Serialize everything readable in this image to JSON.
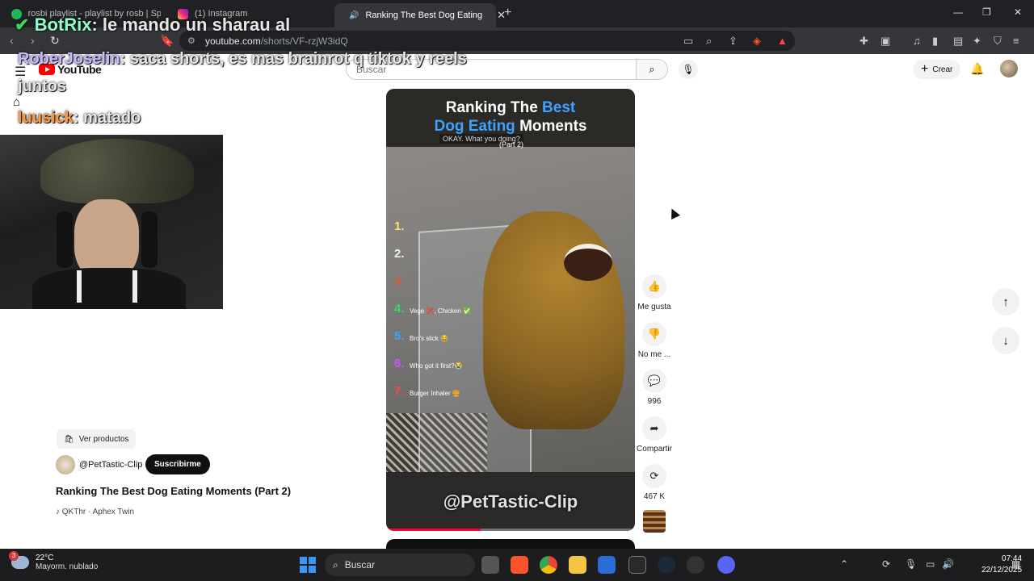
{
  "browser": {
    "tabs": [
      {
        "title": "rosbi playlist - playlist by rosb | Spoti",
        "color": "#1db954",
        "active": false
      },
      {
        "title": "(1) Instagram",
        "color": "#d6249f",
        "active": false
      },
      {
        "title": "Ranking The Best Dog Eating",
        "color": "#ff0000",
        "active": true
      }
    ],
    "url_host": "youtube.com",
    "url_path": "/shorts/VF-rzjW3idQ"
  },
  "stream_chat": [
    {
      "user": "BotRix",
      "text": "le mando un sharau al"
    },
    {
      "user": "RoberJoselin",
      "text": "saca shorts, es mas brainrot q tiktok y reels"
    },
    {
      "user": "",
      "text": "juntos"
    },
    {
      "user": "luusick",
      "text": "matado"
    }
  ],
  "youtube": {
    "logo_text": "YouTube",
    "search_placeholder": "Buscar",
    "create_label": "Crear"
  },
  "video": {
    "title_pre": "Ranking The ",
    "title_hl1": "Best",
    "title_hl2": "Dog Eating",
    "title_post": " Moments",
    "subtitle": "OKAY. What you doing?",
    "part": "(Part 2)",
    "ranks": [
      {
        "n": "1.",
        "text": "",
        "color": "#ffe066"
      },
      {
        "n": "2.",
        "text": "",
        "color": "#eeeeee"
      },
      {
        "n": "3.",
        "text": "",
        "color": "#d65d2a"
      },
      {
        "n": "4.",
        "text": "Vege ❌, Chicken ✅",
        "color": "#3cd65a"
      },
      {
        "n": "5.",
        "text": "Bro's slick 😂",
        "color": "#3aa3ff"
      },
      {
        "n": "6.",
        "text": "Who got it first?😭",
        "color": "#c455ff"
      },
      {
        "n": "7.",
        "text": "Burger Inhaler 🍔",
        "color": "#ff4444"
      }
    ],
    "handle_overlay": "@PetTastic-Clip",
    "progress_fraction": 0.38
  },
  "actions": {
    "like": "Me gusta",
    "dislike": "No me ...",
    "comments": "996",
    "share": "Compartir",
    "remix": "467 K"
  },
  "info": {
    "products": "Ver productos",
    "channel": "@PetTastic-Clip",
    "subscribe": "Suscribirme",
    "title": "Ranking The Best Dog Eating Moments (Part 2)",
    "music": "QKThr · Aphex Twin"
  },
  "taskbar": {
    "temp": "22°C",
    "weather": "Mayorm. nublado",
    "weather_badge": "3",
    "search": "Buscar",
    "time": "07:44",
    "date": "22/12/2025"
  }
}
